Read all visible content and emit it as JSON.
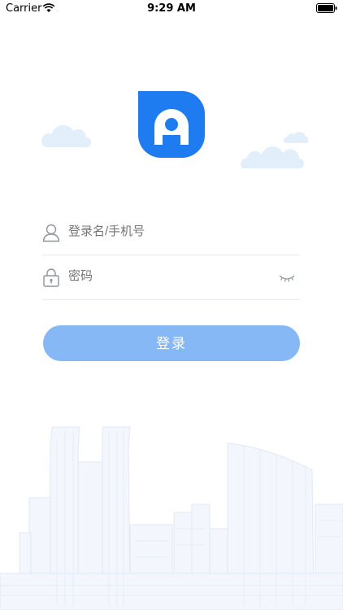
{
  "status_bar": {
    "carrier": "Carrier",
    "time": "9:29 AM",
    "icons": [
      "wifi-icon",
      "battery-icon"
    ]
  },
  "brand": {
    "logo_icon": "app-logo-a",
    "accent_color": "#1e7cf0"
  },
  "login_form": {
    "username_placeholder": "登录名/手机号",
    "password_placeholder": "密码",
    "username_icon": "user-icon",
    "password_icon": "lock-icon",
    "password_visibility_icon": "eye-closed-icon",
    "submit_label": "登录",
    "submit_color": "#86b8f5"
  },
  "decor": {
    "clouds": [
      "cloud-icon",
      "cloud-icon",
      "cloud-icon"
    ],
    "background": "city-skyline-illustration"
  }
}
